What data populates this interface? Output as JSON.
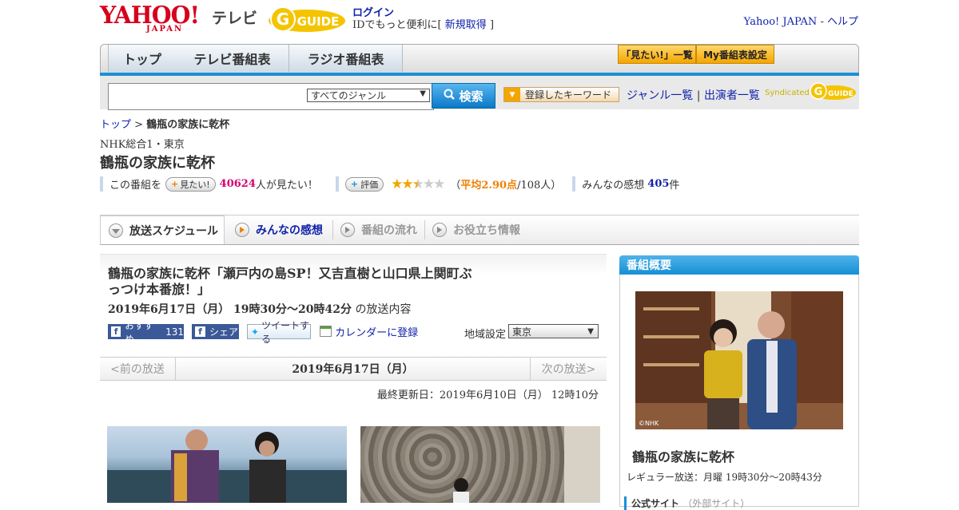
{
  "header": {
    "logo_yahoo": "YAHOO!",
    "logo_japan": "JAPAN",
    "logo_tv": "テレビ",
    "logo_gguide": "GUIDE",
    "login_label": "ログイン",
    "login_note_prefix": "IDでもっと便利に[",
    "signup_label": "新規取得",
    "login_note_suffix": "]",
    "yahoo_japan_link": "Yahoo! JAPAN",
    "link_separator": "-",
    "help_link": "ヘルプ"
  },
  "nav": {
    "tabs": [
      {
        "label": "トップ"
      },
      {
        "label": "テレビ番組表"
      },
      {
        "label": "ラジオ番組表"
      }
    ],
    "want_list_label": "「見たい!」一覧",
    "my_schedule_label": "My番組表設定"
  },
  "search": {
    "input_value": "",
    "genre_value": "すべてのジャンル",
    "search_button_label": "検索",
    "keyword_button_label": "登録したキーワード",
    "genre_list_link": "ジャンル一覧",
    "link_separator": "|",
    "performer_list_link": "出演者一覧",
    "syndicated_label": "Syndicated"
  },
  "breadcrumb": {
    "home": "トップ",
    "separator": ">",
    "current": "鶴瓶の家族に乾杯"
  },
  "program": {
    "channel": "NHK総合1・東京",
    "title": "鶴瓶の家族に乾杯",
    "want_prefix": "この番組を",
    "want_button_label": "見たい!",
    "want_count": "40624",
    "want_suffix": "人が見たい！",
    "rate_button_label": "評価",
    "rating_value": 2.5,
    "rating_open": "（",
    "rating_avg": "平均2.90点",
    "rating_count": "/108人）",
    "review_prefix": "みんなの感想",
    "review_count": "405",
    "review_suffix": "件"
  },
  "subtabs": [
    {
      "label": "放送スケジュール"
    },
    {
      "label": "みんなの感想"
    },
    {
      "label": "番組の流れ"
    },
    {
      "label": "お役立ち情報"
    }
  ],
  "episode": {
    "title": "鶴瓶の家族に乾杯「瀬戸内の島SP！又吉直樹と山口県上関町ぶっつけ本番旅！」",
    "datetime": "2019年6月17日（月）  19時30分～20時42分",
    "datetime_suffix": "の放送内容",
    "fb_recommend_label": "おすすめ",
    "fb_recommend_count": "131",
    "fb_share_label": "シェア",
    "tweet_label": "ツイートする",
    "calendar_label": "カレンダーに登録",
    "region_label": "地域設定",
    "region_value": "東京",
    "prev_label": "<前の放送",
    "current_date": "2019年6月17日（月）",
    "next_label": "次の放送>",
    "updated": "最終更新日：2019年6月10日（月）  12時10分"
  },
  "sidebar": {
    "heading": "番組概要",
    "photo_credit": "©NHK",
    "title": "鶴瓶の家族に乾杯",
    "regular": "レギュラー放送：月曜 19時30分～20時43分",
    "official_label": "公式サイト",
    "official_note": "（外部サイト）"
  },
  "colors": {
    "accent_blue": "#1c8fd6",
    "yahoo_red": "#d6001c",
    "highlight_pink": "#d6006e",
    "star": "#f0a500"
  }
}
